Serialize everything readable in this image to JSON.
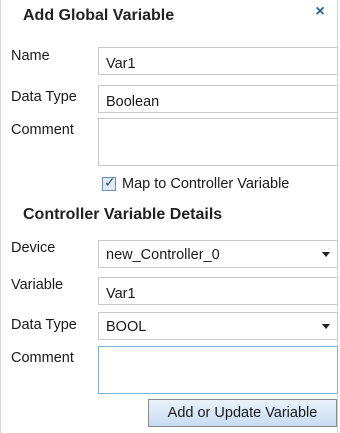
{
  "dialog": {
    "title": "Add Global Variable",
    "close_label": "×"
  },
  "global": {
    "name_label": "Name",
    "name_value": "Var1",
    "data_type_label": "Data Type",
    "data_type_value": "Boolean",
    "comment_label": "Comment",
    "comment_value": "",
    "map_checkbox_label": "Map to Controller Variable",
    "map_checked": true
  },
  "controller": {
    "section_title": "Controller Variable Details",
    "device_label": "Device",
    "device_value": "new_Controller_0",
    "variable_label": "Variable",
    "variable_value": "Var1",
    "data_type_label": "Data Type",
    "data_type_value": "BOOL",
    "comment_label": "Comment",
    "comment_value": ""
  },
  "actions": {
    "submit_label": "Add or Update Variable"
  }
}
